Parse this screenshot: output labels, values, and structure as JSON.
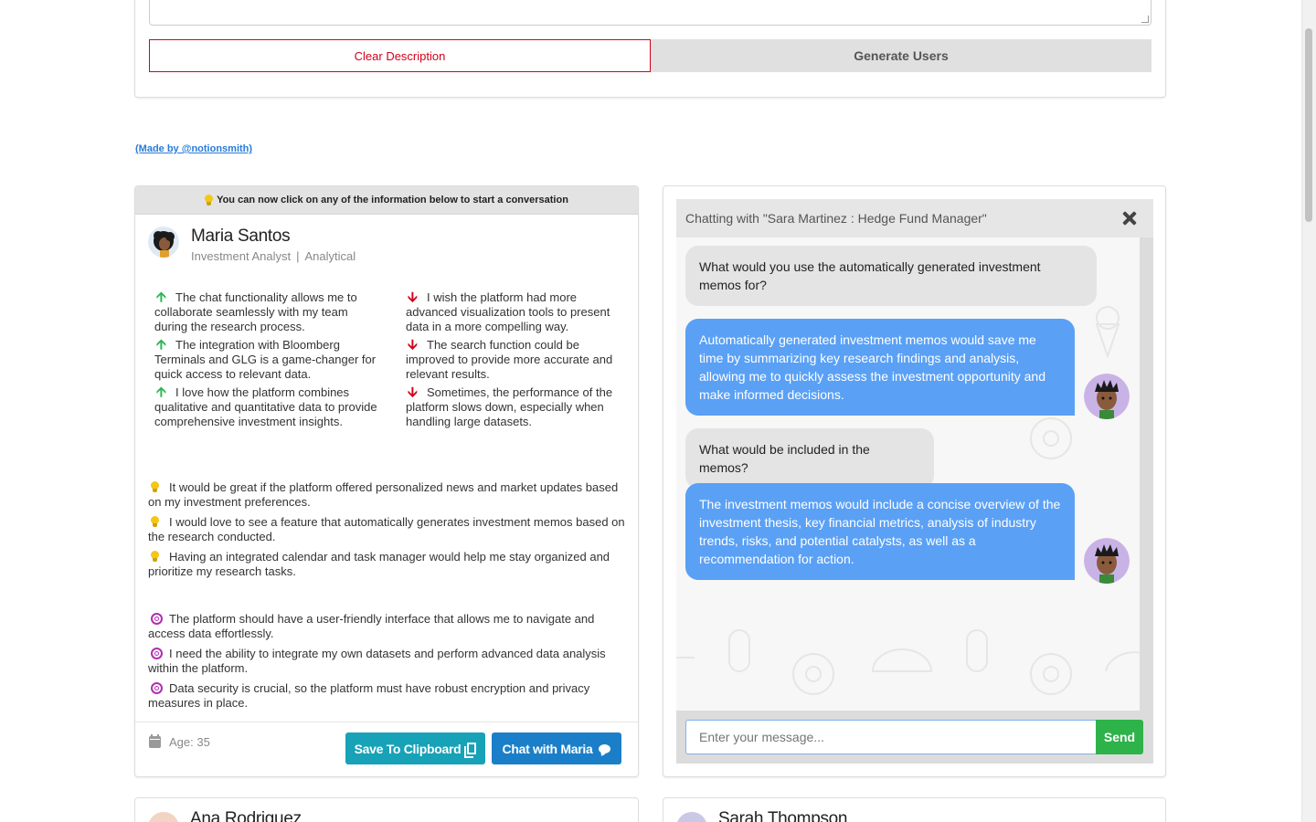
{
  "form": {
    "clear_label": "Clear Description",
    "generate_label": "Generate Users"
  },
  "made_by": "(Made by @notionsmith)",
  "persona": {
    "banner": "You can now click on any of the information below to start a conversation",
    "name": "Maria Santos",
    "role": "Investment Analyst",
    "separator": "|",
    "trait": "Analytical",
    "pros": [
      "The chat functionality allows me to collaborate seamlessly with my team during the research process.",
      "The integration with Bloomberg Terminals and GLG is a game-changer for quick access to relevant data.",
      "I love how the platform combines qualitative and quantitative data to provide comprehensive investment insights."
    ],
    "cons": [
      "I wish the platform had more advanced visualization tools to present data in a more compelling way.",
      "The search function could be improved to provide more accurate and relevant results.",
      "Sometimes, the performance of the platform slows down, especially when handling large datasets."
    ],
    "ideas": [
      "It would be great if the platform offered personalized news and market updates based on my investment preferences.",
      "I would love to see a feature that automatically generates investment memos based on the research conducted.",
      "Having an integrated calendar and task manager would help me stay organized and prioritize my research tasks."
    ],
    "goals": [
      "The platform should have a user-friendly interface that allows me to navigate and access data effortlessly.",
      "I need the ability to integrate my own datasets and perform advanced data analysis within the platform.",
      "Data security is crucial, so the platform must have robust encryption and privacy measures in place."
    ],
    "age": "Age: 35",
    "clipboard_label": "Save To Clipboard",
    "chat_label": "Chat with Maria"
  },
  "chat": {
    "title": "Chatting with \"Sara Martinez : Hedge Fund Manager\"",
    "messages": [
      {
        "from": "user",
        "text": "What would you use the automatically generated investment memos for?"
      },
      {
        "from": "bot",
        "text": "Automatically generated investment memos would save me time by summarizing key research findings and analysis, allowing me to quickly assess the investment opportunity and make informed decisions."
      },
      {
        "from": "user",
        "text": "What would be included in the memos?"
      },
      {
        "from": "bot",
        "text": "The investment memos would include a concise overview of the investment thesis, key financial metrics, analysis of industry trends, risks, and potential catalysts, as well as a recommendation for action."
      }
    ],
    "input_placeholder": "Enter your message...",
    "send_label": "Send"
  },
  "next_personas": [
    "Ana Rodriguez",
    "Sarah Thompson"
  ],
  "colors": {
    "up_arrow": "#2fb457",
    "down_arrow": "#d0021b",
    "bot_bubble": "#5aa0f5",
    "send": "#2db34a",
    "clipboard_button": "#17a2b8",
    "chat_button": "#1a7fc8",
    "goal_icon": "#b02fb0",
    "idea_icon": "#f5c518"
  },
  "icons": {
    "pro": "arrow-up-icon",
    "con": "arrow-down-icon",
    "idea": "lightbulb-icon",
    "goal": "target-icon",
    "age": "calendar-icon",
    "clipboard": "clipboard-icon",
    "chat": "chat-bubble-icon",
    "close": "close-icon"
  }
}
